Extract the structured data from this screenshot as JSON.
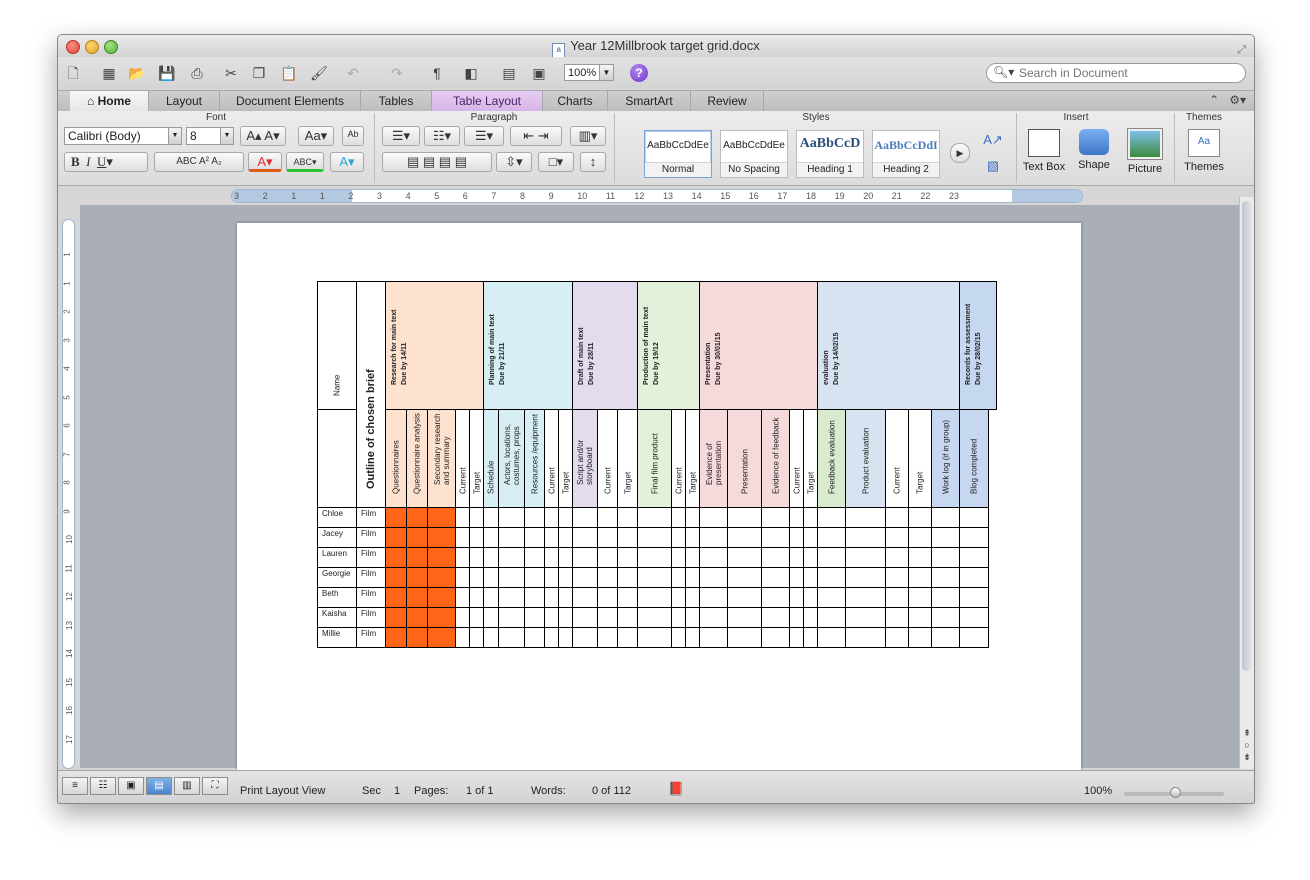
{
  "window": {
    "title": "Year 12Millbrook target grid.docx"
  },
  "toolbar": {
    "zoom": "100%",
    "search_placeholder": "Search in Document"
  },
  "tabs": [
    "Home",
    "Layout",
    "Document Elements",
    "Tables",
    "Table Layout",
    "Charts",
    "SmartArt",
    "Review"
  ],
  "ribbon": {
    "groups": {
      "font": "Font",
      "paragraph": "Paragraph",
      "styles": "Styles",
      "insert": "Insert",
      "themes": "Themes"
    },
    "font_name": "Calibri (Body)",
    "font_size": "8",
    "styles": [
      {
        "sample": "AaBbCcDdEe",
        "name": "Normal"
      },
      {
        "sample": "AaBbCcDdEe",
        "name": "No Spacing"
      },
      {
        "sample": "AaBbCcD",
        "name": "Heading 1"
      },
      {
        "sample": "AaBbCcDdI",
        "name": "Heading 2"
      }
    ],
    "insert_buttons": [
      "Text Box",
      "Shape",
      "Picture"
    ],
    "themes_button": "Themes"
  },
  "ruler": {
    "h_numbers": [
      "3",
      "2",
      "1",
      "1",
      "2",
      "3",
      "4",
      "5",
      "6",
      "7",
      "8",
      "9",
      "10",
      "11",
      "12",
      "13",
      "14",
      "15",
      "16",
      "17",
      "18",
      "19",
      "20",
      "21",
      "22",
      "23"
    ],
    "v_numbers": [
      "1",
      "1",
      "2",
      "3",
      "4",
      "5",
      "6",
      "7",
      "8",
      "9",
      "10",
      "11",
      "12",
      "13",
      "14",
      "15",
      "16",
      "17"
    ]
  },
  "status": {
    "view": "Print Layout View",
    "sec_label": "Sec",
    "sec_value": "1",
    "pages_label": "Pages:",
    "pages_value": "1 of 1",
    "words_label": "Words:",
    "words_value": "0 of 112",
    "zoom": "100%"
  },
  "table": {
    "name_header": "Name",
    "brief_header": "Outline of chosen brief",
    "sections": [
      {
        "title": "Research for main text\nDue by 14/11",
        "color": "#fde3cf"
      },
      {
        "title": "Planning of main text\nDue by 21/11",
        "color": "#d6eef4"
      },
      {
        "title": "Draft of main text\nDue by 28/11",
        "color": "#e4dcee"
      },
      {
        "title": "Production of main text\nDue by 19/12",
        "color": "#e3f0da"
      },
      {
        "title": "Presentation\nDue by 30/01/15",
        "color": "#f6dadb"
      },
      {
        "title": "evaluation\nDue by 14/02/15",
        "color": "#d8e3f2"
      },
      {
        "title": "Records for assessment\nDue by 28/02/15",
        "color": "#c5d8f0"
      }
    ],
    "subheaders": [
      {
        "text": "Questionnaires",
        "color": "#fde3cf"
      },
      {
        "text": "Questionnaire analysis",
        "color": "#fde3cf"
      },
      {
        "text": "Secondary research , and summary",
        "color": "#fde3cf"
      },
      {
        "text": "Current",
        "color": "#ffffff"
      },
      {
        "text": "Target",
        "color": "#ffffff"
      },
      {
        "text": "Schedule",
        "color": "#d6eef4"
      },
      {
        "text": "Actors, locations, costumes, props",
        "color": "#d6eef4"
      },
      {
        "text": "Resources /equipment",
        "color": "#d6eef4"
      },
      {
        "text": "Current",
        "color": "#ffffff"
      },
      {
        "text": "Target",
        "color": "#ffffff"
      },
      {
        "text": "Script and/or storyboard",
        "color": "#e4dcee"
      },
      {
        "text": "Current",
        "color": "#ffffff"
      },
      {
        "text": "Target",
        "color": "#ffffff"
      },
      {
        "text": "Final film product",
        "color": "#e3f0da"
      },
      {
        "text": "Current",
        "color": "#ffffff"
      },
      {
        "text": "Target",
        "color": "#ffffff"
      },
      {
        "text": "Evidence of presentation",
        "color": "#f6dadb"
      },
      {
        "text": "Presentation",
        "color": "#f6dadb"
      },
      {
        "text": "Evidence of feedback",
        "color": "#f6dadb"
      },
      {
        "text": "Current",
        "color": "#ffffff"
      },
      {
        "text": "Target",
        "color": "#ffffff"
      },
      {
        "text": "Feedback evaluation",
        "color": "#d9ebcf"
      },
      {
        "text": "Product evaluation",
        "color": "#d8e3f2"
      },
      {
        "text": "Current",
        "color": "#ffffff"
      },
      {
        "text": "Target",
        "color": "#ffffff"
      },
      {
        "text": "Work log (if in group)",
        "color": "#c5d8f0"
      },
      {
        "text": "Blog completed",
        "color": "#c5d8f0"
      }
    ],
    "rows": [
      {
        "name": "Chloe",
        "brief": "Film"
      },
      {
        "name": "Jacey",
        "brief": "Film"
      },
      {
        "name": "Lauren",
        "brief": "Film"
      },
      {
        "name": "Georgie",
        "brief": "Film"
      },
      {
        "name": "Beth",
        "brief": "Film"
      },
      {
        "name": "Kaisha",
        "brief": "Film"
      },
      {
        "name": "Millie",
        "brief": "Film"
      }
    ],
    "filled_color": "#ff6619"
  }
}
